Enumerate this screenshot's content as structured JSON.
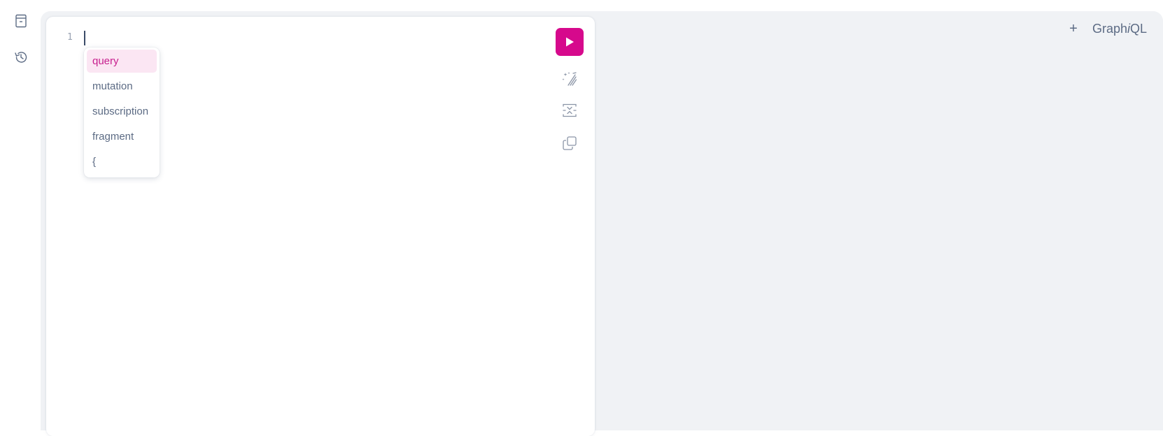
{
  "sidebar": {
    "docs_icon": "book-icon",
    "history_icon": "history-icon"
  },
  "editor": {
    "line_numbers": [
      "1"
    ],
    "content": ""
  },
  "autocomplete": {
    "items": [
      "query",
      "mutation",
      "subscription",
      "fragment",
      "{"
    ],
    "active_index": 0
  },
  "toolbar": {
    "run_icon": "play-icon",
    "prettify_icon": "magic-wand-icon",
    "merge_icon": "merge-fragments-icon",
    "copy_icon": "copy-icon"
  },
  "tabs": {
    "add_label": "+"
  },
  "brand": {
    "part1": "Graph",
    "part2": "i",
    "part3": "QL"
  },
  "colors": {
    "accent": "#d6098c",
    "background": "#f0f2f5",
    "text": "#3b4b68"
  }
}
